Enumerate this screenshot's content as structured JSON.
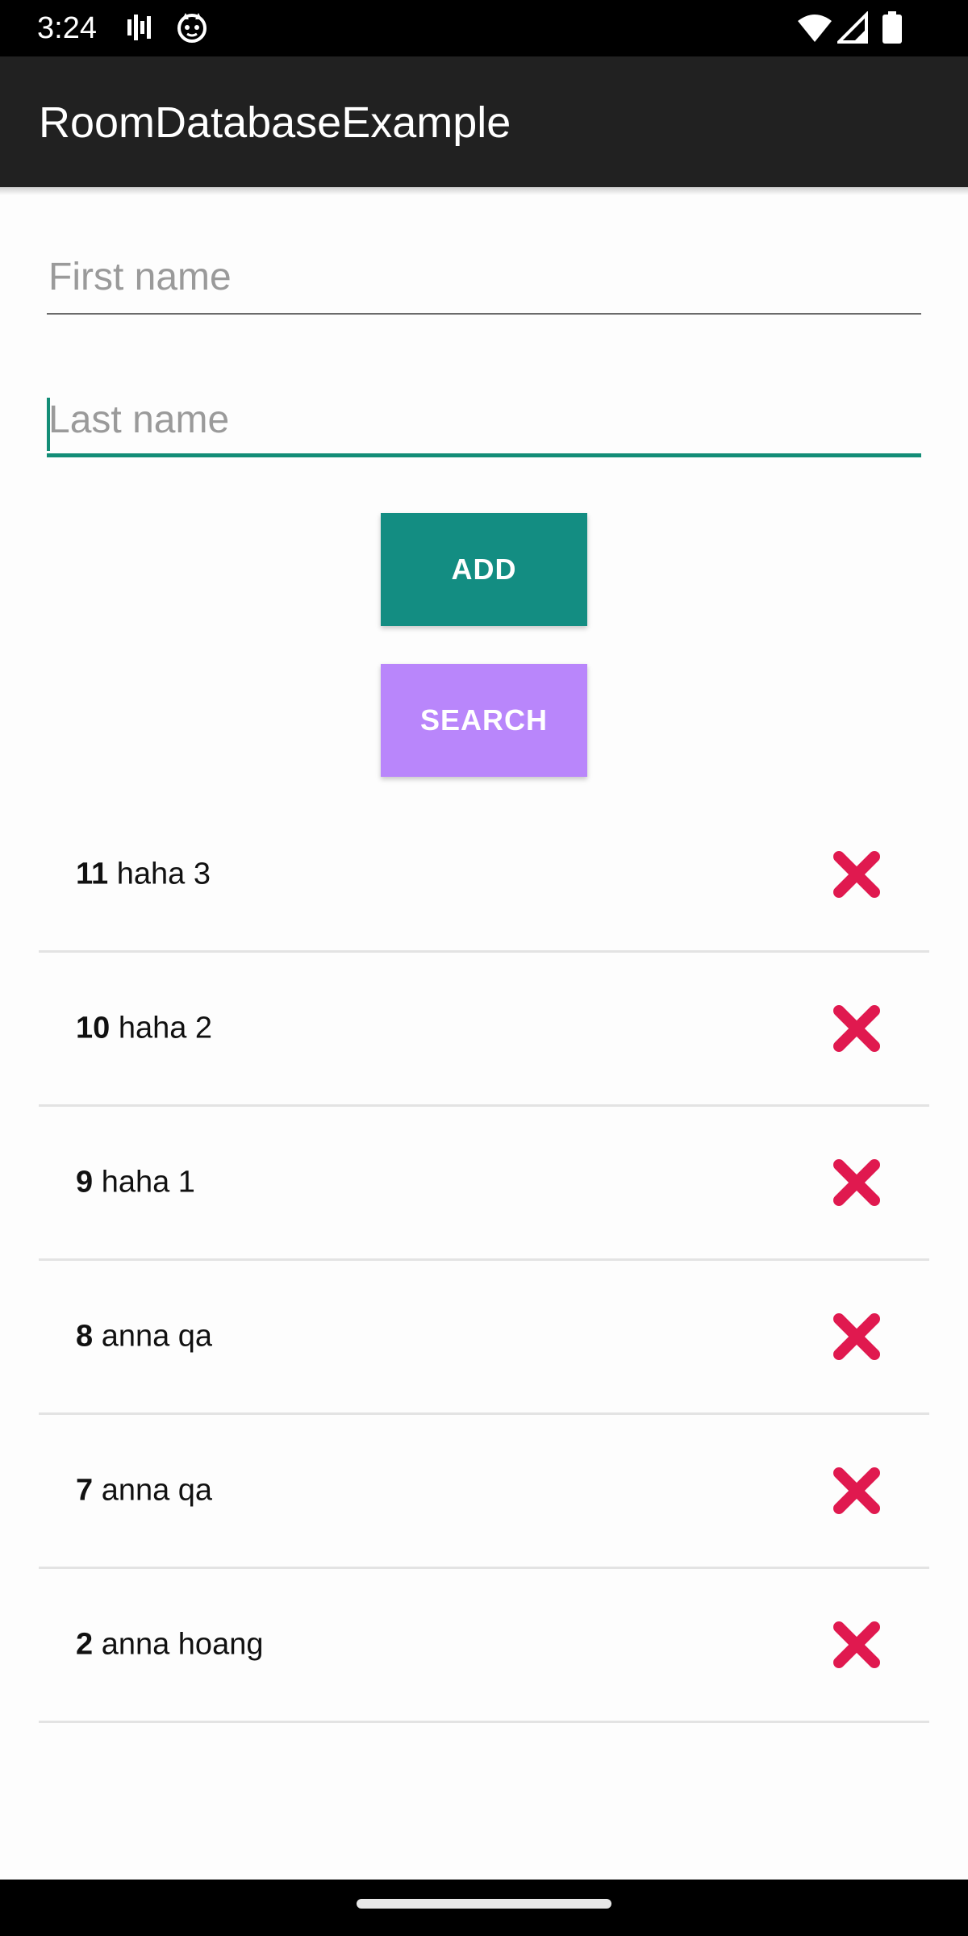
{
  "status_bar": {
    "time": "3:24",
    "left_icons": [
      "signal-bars-icon",
      "cat-face-icon"
    ],
    "right_icons": [
      "wifi-icon",
      "cellular-signal-icon",
      "battery-icon"
    ]
  },
  "app_bar": {
    "title": "RoomDatabaseExample"
  },
  "form": {
    "first_name": {
      "value": "",
      "placeholder": "First name"
    },
    "last_name": {
      "value": "",
      "placeholder": "Last name",
      "focused": true
    },
    "add_label": "ADD",
    "search_label": "SEARCH"
  },
  "users": [
    {
      "id": "11",
      "name": "haha 3",
      "delete_icon": "close-icon"
    },
    {
      "id": "10",
      "name": "haha 2",
      "delete_icon": "close-icon"
    },
    {
      "id": "9",
      "name": "haha 1",
      "delete_icon": "close-icon"
    },
    {
      "id": "8",
      "name": "anna qa",
      "delete_icon": "close-icon"
    },
    {
      "id": "7",
      "name": "anna qa",
      "delete_icon": "close-icon"
    },
    {
      "id": "2",
      "name": "anna hoang",
      "delete_icon": "close-icon"
    }
  ],
  "colors": {
    "app_bar": "#212121",
    "add_button": "#138d82",
    "search_button": "#b986fb",
    "focus_accent": "#138d77",
    "delete_icon": "#e0194f"
  }
}
